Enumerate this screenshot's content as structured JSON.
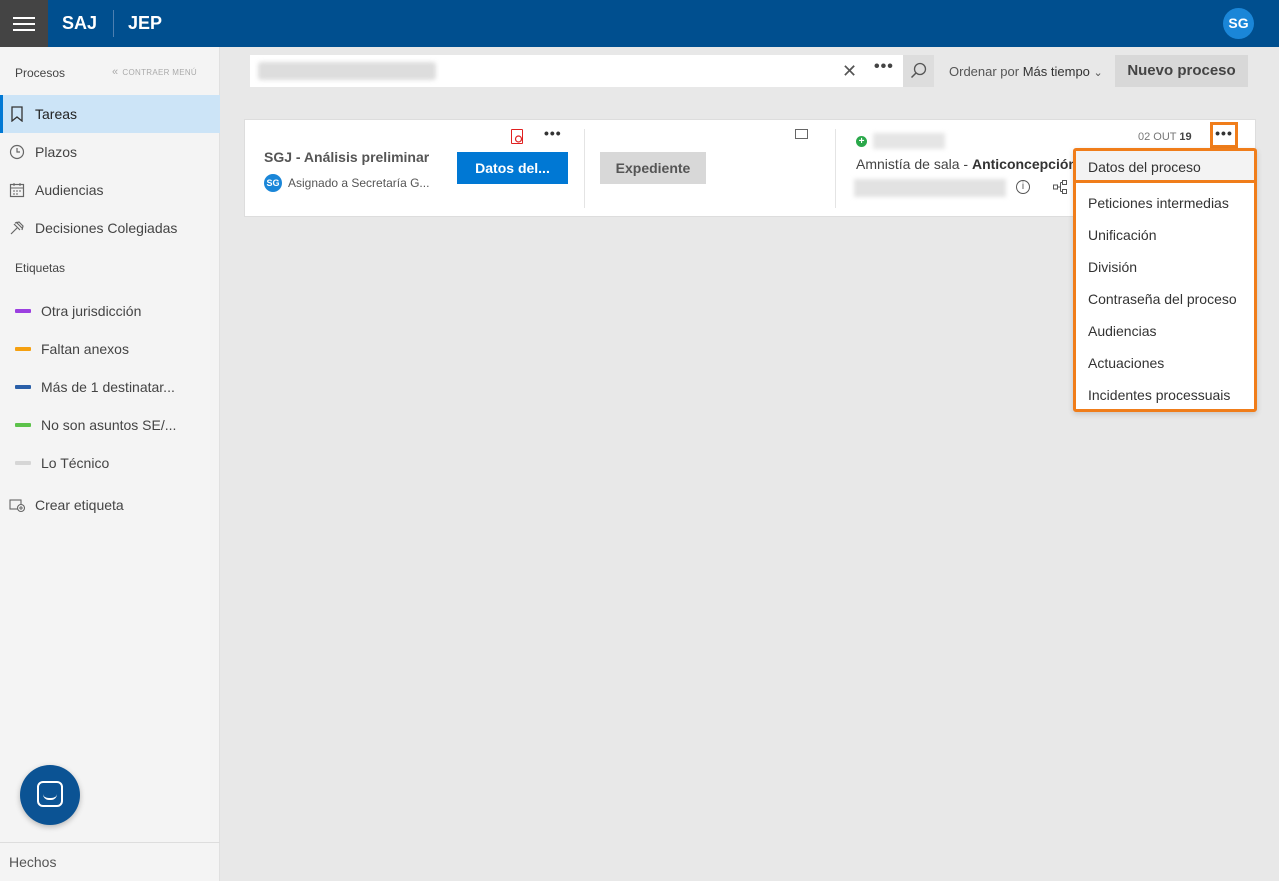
{
  "topbar": {
    "brand_left": "SAJ",
    "brand_right": "JEP",
    "user_initials": "SG"
  },
  "sidebar": {
    "title": "Procesos",
    "collapse_label": "CONTRAER MENÚ",
    "items": [
      {
        "label": "Tareas",
        "icon": "bookmark-icon",
        "active": true
      },
      {
        "label": "Plazos",
        "icon": "clock-icon"
      },
      {
        "label": "Audiencias",
        "icon": "calendar-icon"
      },
      {
        "label": "Decisiones Colegiadas",
        "icon": "gavel-icon"
      }
    ],
    "tags_title": "Etiquetas",
    "tags": [
      {
        "label": "Otra jurisdicción",
        "color": "#9b3fe0"
      },
      {
        "label": "Faltan anexos",
        "color": "#f5a010"
      },
      {
        "label": "Más de 1 destinatar...",
        "color": "#2a5fa8"
      },
      {
        "label": "No son asuntos SE/...",
        "color": "#5cc24a"
      },
      {
        "label": "Lo Técnico",
        "color": "#d6d6d6"
      }
    ],
    "create_tag": "Crear etiqueta",
    "footer": "Hechos"
  },
  "toolbar": {
    "clear_symbol": "✕",
    "more_symbol": "•••",
    "sort_prefix": "Ordenar por",
    "sort_value": "Más tiempo",
    "new_process": "Nuevo proceso"
  },
  "card": {
    "task_title": "SGJ - Análisis preliminar",
    "assigned_initials": "SG",
    "assigned_text": "Asignado a Secretaría G...",
    "datos_button": "Datos del...",
    "expediente_button": "Expediente",
    "process_prefix": "Amnistía de sala -",
    "process_name": "Anticoncepción",
    "date_prefix": "02 OUT",
    "date_day": "19",
    "more_symbol": "•••"
  },
  "menu": {
    "items": [
      "Datos del proceso",
      "Peticiones intermedias",
      "Unificación",
      "División",
      "Contraseña del proceso",
      "Audiencias",
      "Actuaciones",
      "Incidentes processuais"
    ]
  },
  "colors": {
    "topbar": "#004f8f",
    "primary": "#0078d4",
    "highlight": "#f07d1a"
  }
}
